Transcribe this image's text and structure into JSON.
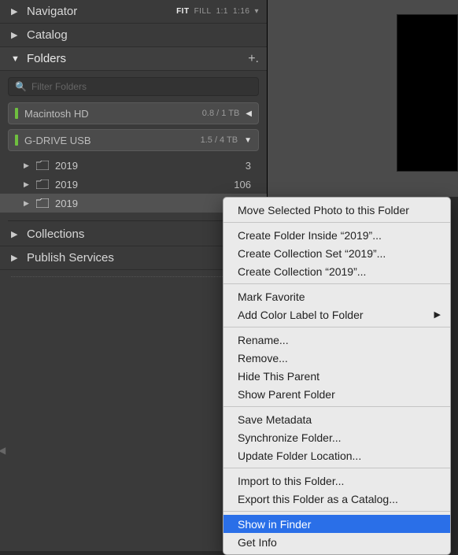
{
  "panels": {
    "navigator": {
      "label": "Navigator"
    },
    "catalog": {
      "label": "Catalog"
    },
    "folders": {
      "label": "Folders"
    },
    "collections": {
      "label": "Collections"
    },
    "publish": {
      "label": "Publish Services"
    }
  },
  "zoom": {
    "fit": "FIT",
    "fill": "FILL",
    "one": "1:1",
    "more": "1:16"
  },
  "filter": {
    "placeholder": "Filter Folders"
  },
  "volumes": [
    {
      "name": "Macintosh HD",
      "stat": "0.8 / 1 TB",
      "expanded": false
    },
    {
      "name": "G-DRIVE USB",
      "stat": "1.5 / 4 TB",
      "expanded": true
    }
  ],
  "folders": [
    {
      "name": "2019",
      "count": "3"
    },
    {
      "name": "2019",
      "count": "106"
    },
    {
      "name": "2019",
      "count": ""
    }
  ],
  "menu": {
    "g0": [
      "Move Selected Photo to this Folder"
    ],
    "g1": [
      "Create Folder Inside “2019”...",
      "Create Collection Set “2019”...",
      "Create Collection “2019”..."
    ],
    "g2sub": "Add Color Label to Folder",
    "g2": [
      "Mark Favorite"
    ],
    "g3": [
      "Rename...",
      "Remove...",
      "Hide This Parent",
      "Show Parent Folder"
    ],
    "g4": [
      "Save Metadata",
      "Synchronize Folder...",
      "Update Folder Location..."
    ],
    "g5": [
      "Import to this Folder...",
      "Export this Folder as a Catalog..."
    ],
    "g6": [
      "Show in Finder",
      "Get Info"
    ]
  }
}
